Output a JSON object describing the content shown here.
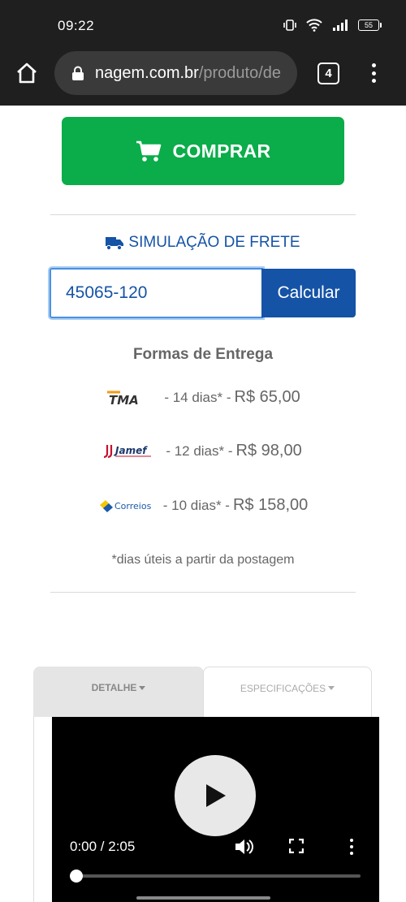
{
  "status": {
    "time": "09:22",
    "battery": "55"
  },
  "browser": {
    "url_domain": "nagem.com.br",
    "url_path": "/produto/de",
    "tab_count": "4"
  },
  "buy": {
    "label": "COMPRAR"
  },
  "freight": {
    "title": "SIMULAÇÃO DE FRETE",
    "cep_value": "45065-120",
    "calc_label": "Calcular",
    "delivery_title": "Formas de Entrega",
    "options": [
      {
        "carrier": "TMA",
        "days": "- 14 dias* -",
        "price": "R$ 65,00"
      },
      {
        "carrier": "Jamef",
        "days": "- 12 dias* -",
        "price": "R$ 98,00"
      },
      {
        "carrier": "Correios",
        "days": "- 10 dias* -",
        "price": "R$ 158,00"
      }
    ],
    "note": "*dias úteis a partir da postagem"
  },
  "tabs": {
    "detail": "DETALHE",
    "specs": "ESPECIFICAÇÕES"
  },
  "video": {
    "time": "0:00 / 2:05",
    "progress": 0
  },
  "colors": {
    "buy_green": "#0aad49",
    "brand_blue": "#1553a6",
    "bar_dark": "#1f1f1f"
  }
}
